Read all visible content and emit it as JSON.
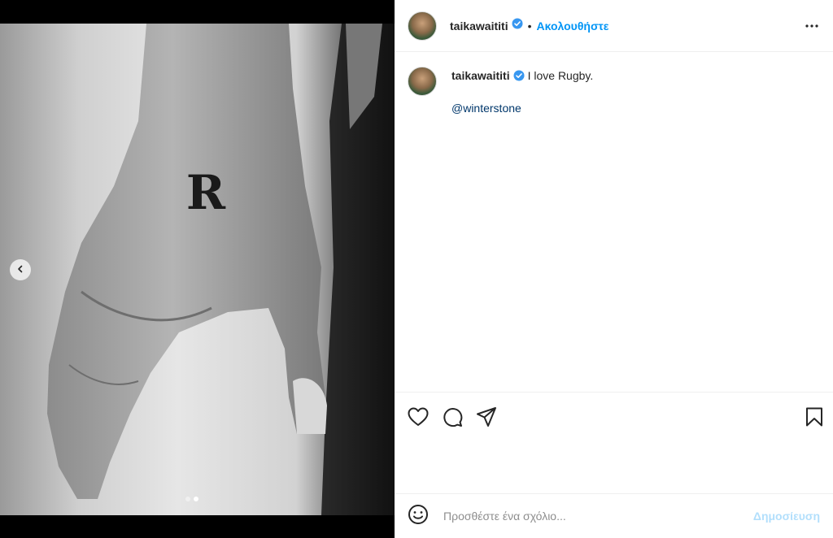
{
  "post": {
    "username": "taikawaititi",
    "follow_label": "Ακολουθήστε",
    "separator": "•",
    "caption": "I love Rugby.",
    "mention": "@winterstone",
    "carousel": {
      "slide_count": 2,
      "active_slide": 2
    },
    "photo_tattoo_letter": "R"
  },
  "comment": {
    "placeholder": "Προσθέστε ένα σχόλιο...",
    "post_label": "Δημοσίευση"
  },
  "icons": {
    "verified": "verified-badge-icon",
    "more": "more-options-icon",
    "like": "heart-icon",
    "comment": "comment-bubble-icon",
    "share": "paper-plane-icon",
    "save": "bookmark-icon",
    "emoji": "emoji-icon",
    "carousel_prev": "chevron-left-icon"
  },
  "colors": {
    "accent": "#0095f6",
    "verified": "#3897f0",
    "mention": "#00376b",
    "post_disabled": "#b2dffc"
  }
}
